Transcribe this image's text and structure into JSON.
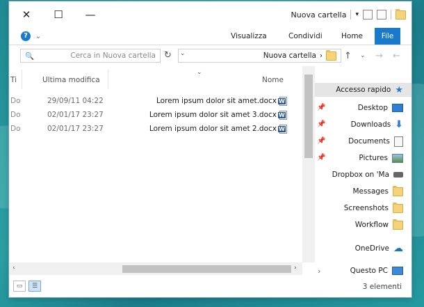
{
  "window": {
    "title": "Nuova cartella"
  },
  "ribbon": {
    "tabs": [
      "File",
      "Home",
      "Condividi",
      "Visualizza"
    ]
  },
  "address": {
    "path": "Nuova cartella",
    "search_placeholder": "Cerca in Nuova cartella"
  },
  "columns": {
    "name": "Nome",
    "modified": "Ultima modifica",
    "type_trunc": "Ti"
  },
  "files": [
    {
      "name": "Lorem ipsum dolor sit amet.docx",
      "modified": "29/09/11 04:22",
      "type_trunc": "Do"
    },
    {
      "name": "Lorem ipsum dolor sit amet 3.docx",
      "modified": "02/01/17 23:27",
      "type_trunc": "Do"
    },
    {
      "name": "Lorem ipsum dolor sit amet 2.docx",
      "modified": "02/01/17 23:27",
      "type_trunc": "Do"
    }
  ],
  "nav": {
    "quick_access": "Accesso rapido",
    "items": [
      "Desktop",
      "Downloads",
      "Documents",
      "Pictures",
      "Dropbox on 'Ma",
      "Messages",
      "Screenshots",
      "Workflow"
    ],
    "onedrive": "OneDrive",
    "this_pc": "Questo PC"
  },
  "status": {
    "count": "3 elementi"
  },
  "colors": {
    "accent": "#1979ca",
    "desktop_bg": "#1f8a93"
  }
}
